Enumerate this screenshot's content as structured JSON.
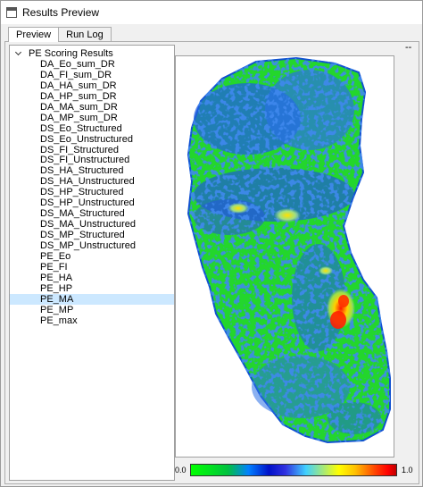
{
  "window": {
    "title": "Results Preview"
  },
  "tabs": [
    {
      "label": "Preview",
      "active": true
    },
    {
      "label": "Run Log",
      "active": false
    }
  ],
  "tree": {
    "root_label": "PE Scoring Results",
    "items": [
      "DA_Eo_sum_DR",
      "DA_FI_sum_DR",
      "DA_HA_sum_DR",
      "DA_HP_sum_DR",
      "DA_MA_sum_DR",
      "DA_MP_sum_DR",
      "DS_Eo_Structured",
      "DS_Eo_Unstructured",
      "DS_FI_Structured",
      "DS_FI_Unstructured",
      "DS_HA_Structured",
      "DS_HA_Unstructured",
      "DS_HP_Structured",
      "DS_HP_Unstructured",
      "DS_MA_Structured",
      "DS_MA_Unstructured",
      "DS_MP_Structured",
      "DS_MP_Unstructured",
      "PE_Eo",
      "PE_FI",
      "PE_HA",
      "PE_HP",
      "PE_MA",
      "PE_MP",
      "PE_max"
    ],
    "selected": "PE_MA"
  },
  "preview": {
    "corner_marker": "--",
    "colorbar": {
      "min_label": "0.0",
      "max_label": "1.0"
    }
  },
  "colors": {
    "selection": "#cce8ff",
    "green": "#22dd22",
    "blue": "#2a5ad8",
    "hotspot_red": "#ff2000",
    "hotspot_yellow": "#ffd000"
  }
}
